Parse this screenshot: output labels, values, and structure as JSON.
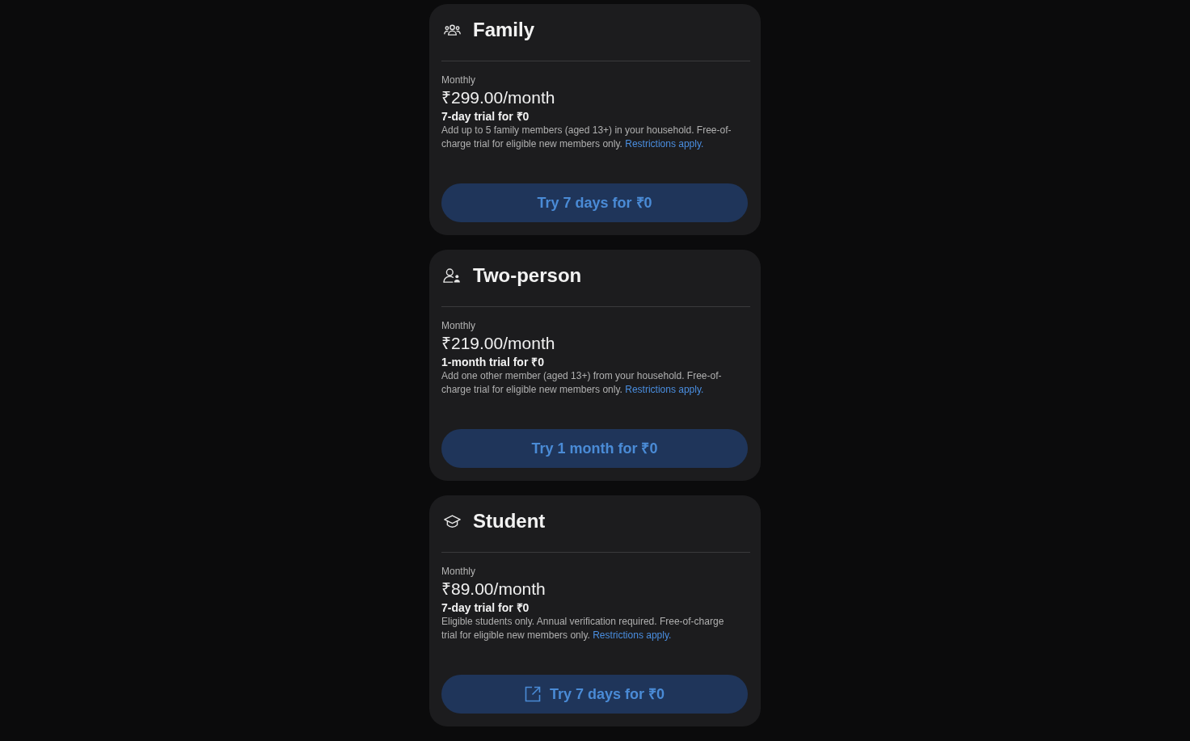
{
  "plans": [
    {
      "kind": "family",
      "name": "Family",
      "billing": "Monthly",
      "price": "₹299.00/month",
      "trial": "7-day trial for ₹0",
      "description": "Add up to 5 family members (aged 13+) in your household. Free-of-charge trial for eligible new members only.",
      "link": "Restrictions apply.",
      "button": {
        "label": "Try 7 days for ₹0",
        "leading_icon": false
      }
    },
    {
      "kind": "two-person",
      "name": "Two-person",
      "billing": "Monthly",
      "price": "₹219.00/month",
      "trial": "1-month trial for ₹0",
      "description": "Add one other member (aged 13+) from your household. Free-of-charge trial for eligible new members only.",
      "link": "Restrictions apply.",
      "button": {
        "label": "Try 1 month for ₹0",
        "leading_icon": false
      }
    },
    {
      "kind": "student",
      "name": "Student",
      "billing": "Monthly",
      "price": "₹89.00/month",
      "trial": "7-day trial for ₹0",
      "description": "Eligible students only. Annual verification required. Free-of-charge trial for eligible new members only.",
      "link": "Restrictions apply.",
      "button": {
        "label": "Try 7 days for ₹0",
        "leading_icon": true
      }
    }
  ]
}
